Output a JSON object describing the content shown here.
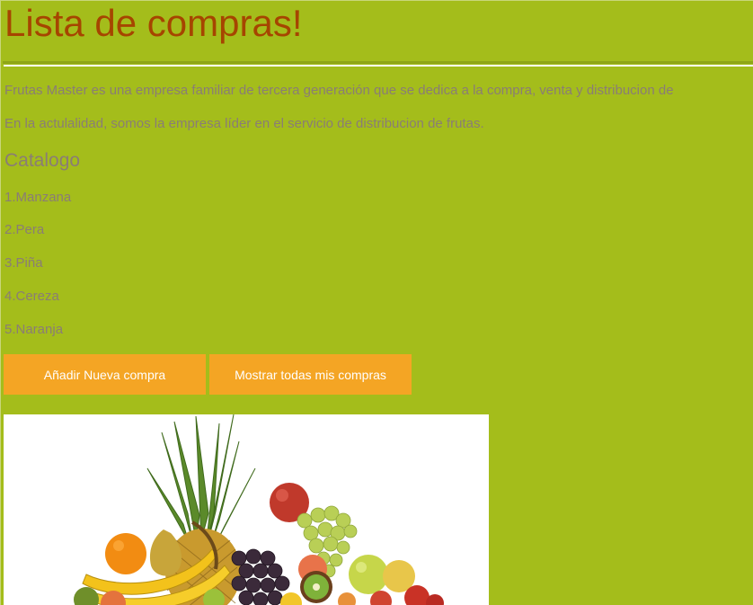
{
  "header": {
    "title": "Lista de compras!"
  },
  "intro": {
    "paragraph_1": "Frutas Master es una empresa familiar de tercera generación que se dedica a la compra, venta y distribucion de",
    "paragraph_2": "En la actulalidad, somos la empresa líder en el servicio de distribucion de frutas."
  },
  "catalog": {
    "heading": "Catalogo",
    "items": [
      "1.Manzana",
      "2.Pera",
      "3.Piña",
      "4.Cereza",
      "5.Naranja"
    ]
  },
  "actions": {
    "add_label": "Añadir Nueva compra",
    "show_all_label": "Mostrar todas mis compras"
  },
  "image": {
    "icon": "fruit-basket-photo"
  },
  "colors": {
    "page_background": "#a4bd1b",
    "title": "#a64500",
    "body_text": "#8a7d75",
    "button": "#f4a524",
    "button_text": "#ffffff"
  }
}
